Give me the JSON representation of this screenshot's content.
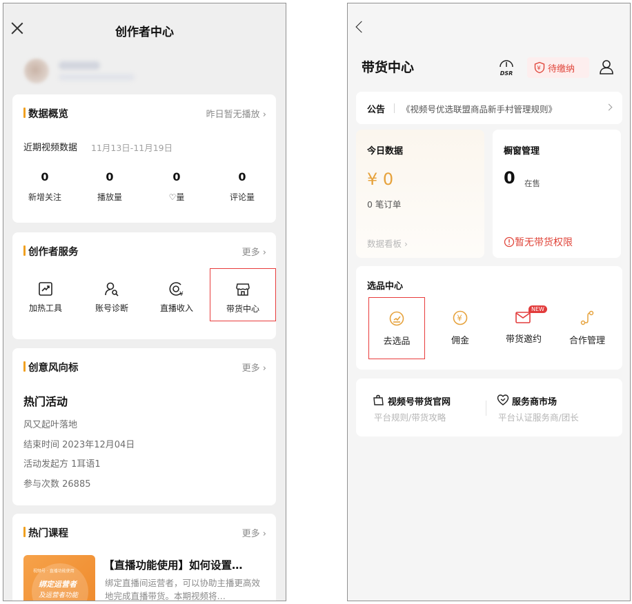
{
  "left": {
    "title": "创作者中心",
    "data_overview": {
      "title": "数据概览",
      "more": "昨日暂无播放",
      "range_label": "近期视频数据",
      "range_value": "11月13日-11月19日",
      "stats": [
        {
          "value": "0",
          "label": "新增关注"
        },
        {
          "value": "0",
          "label": "播放量"
        },
        {
          "value": "0",
          "label": "♡量"
        },
        {
          "value": "0",
          "label": "评论量"
        }
      ]
    },
    "services": {
      "title": "创作者服务",
      "more": "更多",
      "items": [
        {
          "label": "加热工具"
        },
        {
          "label": "账号诊断"
        },
        {
          "label": "直播收入"
        },
        {
          "label": "带货中心"
        }
      ]
    },
    "idea": {
      "title": "创意风向标",
      "more": "更多",
      "headline": "热门活动",
      "lines": [
        "风又起叶落地",
        "结束时间  2023年12月04日",
        "活动发起方  1耳语1",
        "参与次数  26885"
      ]
    },
    "course": {
      "title": "热门课程",
      "more": "更多",
      "thumb_tag": "视频号 · 直播功能使用",
      "thumb_line1": "绑定运营者",
      "thumb_line2": "及运营者功能",
      "item_title": "【直播功能使用】如何设置…",
      "item_desc": "绑定直播间运营者，可以协助主播更高效地完成直播带货。本期视频将…"
    }
  },
  "right": {
    "title": "带货中心",
    "dsr": "DSR",
    "pending": "待缴纳",
    "notice_tag": "公告",
    "notice_text": "《视频号优选联盟商品新手村管理规则》",
    "today": {
      "label": "今日数据",
      "amount": "¥ 0",
      "orders": "0 笔订单",
      "board": "数据看板 ›"
    },
    "window": {
      "label": "橱窗管理",
      "count": "0",
      "unit": "在售",
      "warning": "暂无带货权限"
    },
    "select": {
      "label": "选品中心",
      "items": [
        {
          "label": "去选品"
        },
        {
          "label": "佣金"
        },
        {
          "label": "带货邀约",
          "badge": "NEW"
        },
        {
          "label": "合作管理"
        }
      ]
    },
    "links": [
      {
        "title": "视频号带货官网",
        "sub": "平台规则/带货攻略"
      },
      {
        "title": "服务商市场",
        "sub": "平台认证服务商/团长"
      }
    ]
  },
  "colors": {
    "accent_orange": "#f0a020",
    "amount_gold": "#e6a23c",
    "alert_red": "#e0453a",
    "highlight_red": "#e83a3a"
  }
}
